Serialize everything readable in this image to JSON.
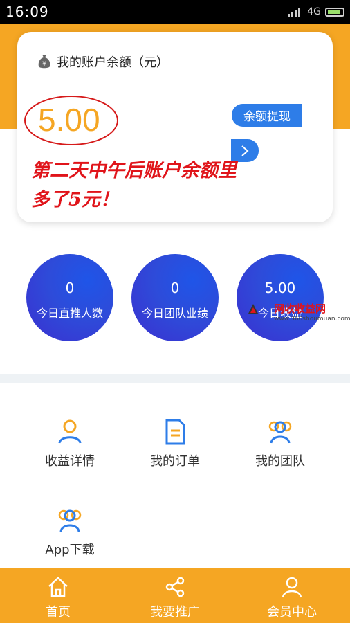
{
  "status_bar": {
    "time": "16:09",
    "network": "4G"
  },
  "balance_card": {
    "title": "我的账户余额（元）",
    "amount": "5.00",
    "withdraw_label": "余额提现",
    "annotation": "第二天中午后账户余额里多了5元！"
  },
  "stats": [
    {
      "value": "0",
      "label": "今日直推人数"
    },
    {
      "value": "0",
      "label": "今日团队业绩"
    },
    {
      "value": "5.00",
      "label": "今日收益"
    }
  ],
  "watermark": {
    "name": "网收收益网",
    "url": "www.360shoumuan.com"
  },
  "menu": [
    {
      "label": "收益详情",
      "icon": "user-icon"
    },
    {
      "label": "我的订单",
      "icon": "document-icon"
    },
    {
      "label": "我的团队",
      "icon": "team-icon"
    },
    {
      "label": "App下载",
      "icon": "team-icon"
    }
  ],
  "bottom_nav": [
    {
      "label": "首页",
      "icon": "home-icon"
    },
    {
      "label": "我要推广",
      "icon": "share-icon"
    },
    {
      "label": "会员中心",
      "icon": "person-icon"
    }
  ],
  "colors": {
    "orange": "#f5a623",
    "blue": "#2e7de8",
    "annotation_red": "#e0141a"
  }
}
